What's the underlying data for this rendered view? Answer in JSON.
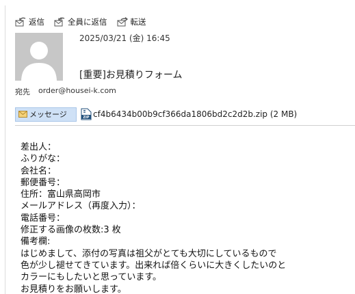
{
  "toolbar": {
    "reply_label": "返信",
    "reply_all_label": "全員に返信",
    "forward_label": "転送"
  },
  "message": {
    "datetime": "2025/03/21 (金) 16:45",
    "subject": "[重要]お見積りフォーム",
    "to_label": "宛先",
    "to_address": "order@housei-k.com"
  },
  "attachments": {
    "message_tab_label": "メッセージ",
    "file_label": "cf4b6434b00b9cf366da1806bd2c2d2b.zip (2 MB)",
    "file_icon_text": "ZIP"
  },
  "body_lines": [
    "差出人：",
    "ふりがな：",
    "会社名：",
    "郵便番号：",
    "住所：富山県高岡市",
    "メールアドレス（再度入力）：",
    "電話番号：",
    "修正する画像の枚数:3 枚",
    "備考欄:",
    "はじめまして、添付の写真は祖父がとても大切にしているもので",
    "色が少し褪せてきています。出来れば倍くらいに大きくしたいのと",
    "カラーにもしたいと思っています。",
    "お見積りをお願いします。"
  ],
  "colors": {
    "message_tab_bg": "#cfe1f6",
    "avatar_bg": "#c7c7c7",
    "zip_icon": "#1f4e79"
  }
}
